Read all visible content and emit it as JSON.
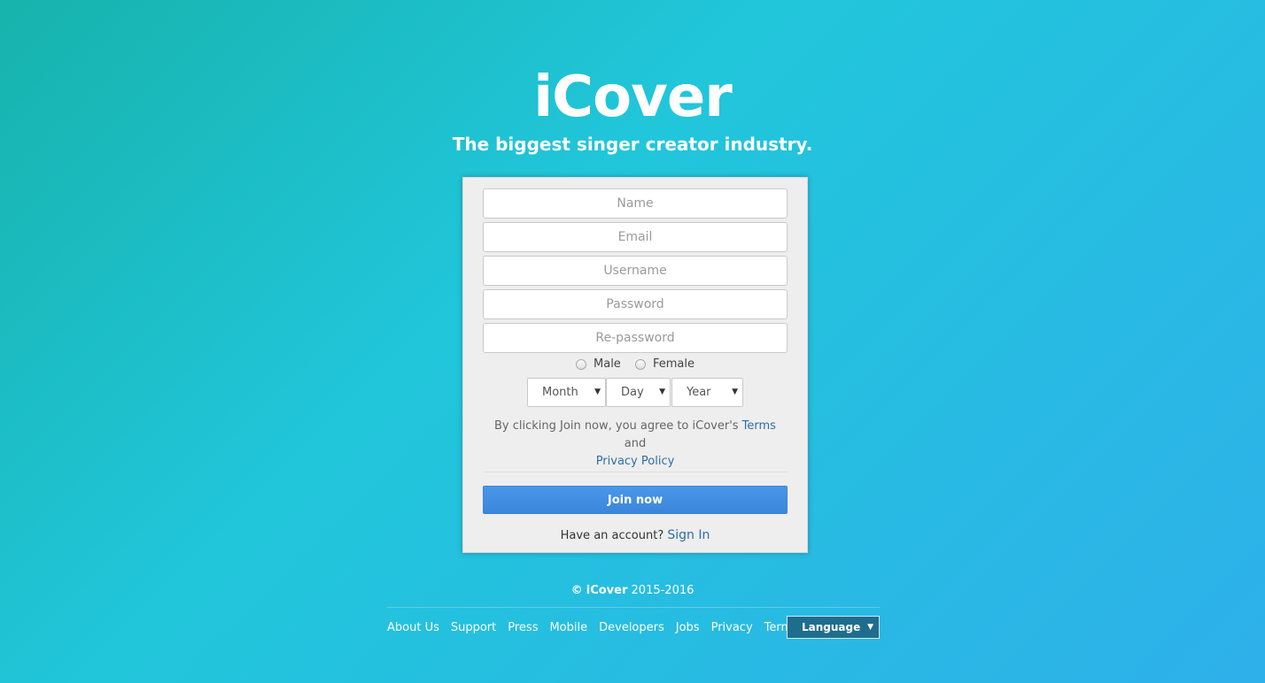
{
  "brand": {
    "logo": "iCover",
    "tagline": "The biggest singer creator industry."
  },
  "form": {
    "name_placeholder": "Name",
    "email_placeholder": "Email",
    "username_placeholder": "Username",
    "password_placeholder": "Password",
    "repassword_placeholder": "Re-password",
    "gender": {
      "male_label": "Male",
      "female_label": "Female"
    },
    "birthday": {
      "month": "Month",
      "day": "Day",
      "year": "Year"
    },
    "terms": {
      "prefix": "By clicking Join now, you agree to iCover's ",
      "terms_link": "Terms",
      "middle": " and ",
      "privacy_link": "Privacy Policy"
    },
    "join_label": "Join now",
    "signin_prompt": "Have an account?",
    "signin_link": "Sign In"
  },
  "footer": {
    "copyright_symbol": "©",
    "copyright_brand": "iCover",
    "copyright_years": "2015-2016",
    "links": [
      "About Us",
      "Support",
      "Press",
      "Mobile",
      "Developers",
      "Jobs",
      "Privacy",
      "Terms"
    ],
    "language_label": "Language"
  },
  "colors": {
    "background_start": "#17b3ac",
    "background_end": "#2eb0ea",
    "join_button": "#3b86db",
    "link": "#2f6ea5",
    "language_button": "#1f6d8e"
  },
  "icons": {
    "dropdown": "chevron-down-icon",
    "radio": "radio-icon"
  }
}
